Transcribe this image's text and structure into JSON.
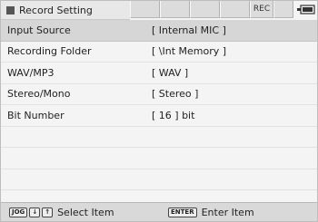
{
  "header": {
    "title": "Record Setting",
    "rec_indicator": "REC"
  },
  "settings": [
    {
      "label": "Input Source",
      "value": "[ Internal MIC ]",
      "selected": true
    },
    {
      "label": "Recording Folder",
      "value": "[ \\Int Memory ]"
    },
    {
      "label": "WAV/MP3",
      "value": "[ WAV ]"
    },
    {
      "label": "Stereo/Mono",
      "value": "[ Stereo ]"
    },
    {
      "label": "Bit Number",
      "value": "[ 16 ] bit"
    },
    {
      "label": "",
      "value": ""
    },
    {
      "label": "",
      "value": ""
    },
    {
      "label": "",
      "value": ""
    }
  ],
  "footer": {
    "jog_key": "JOG",
    "down_key": "↓",
    "up_key": "↑",
    "select_hint": "Select Item",
    "enter_key": "ENTER",
    "enter_hint": "Enter Item"
  },
  "icons": {
    "title": "record-setting-icon",
    "battery": "battery-icon"
  }
}
